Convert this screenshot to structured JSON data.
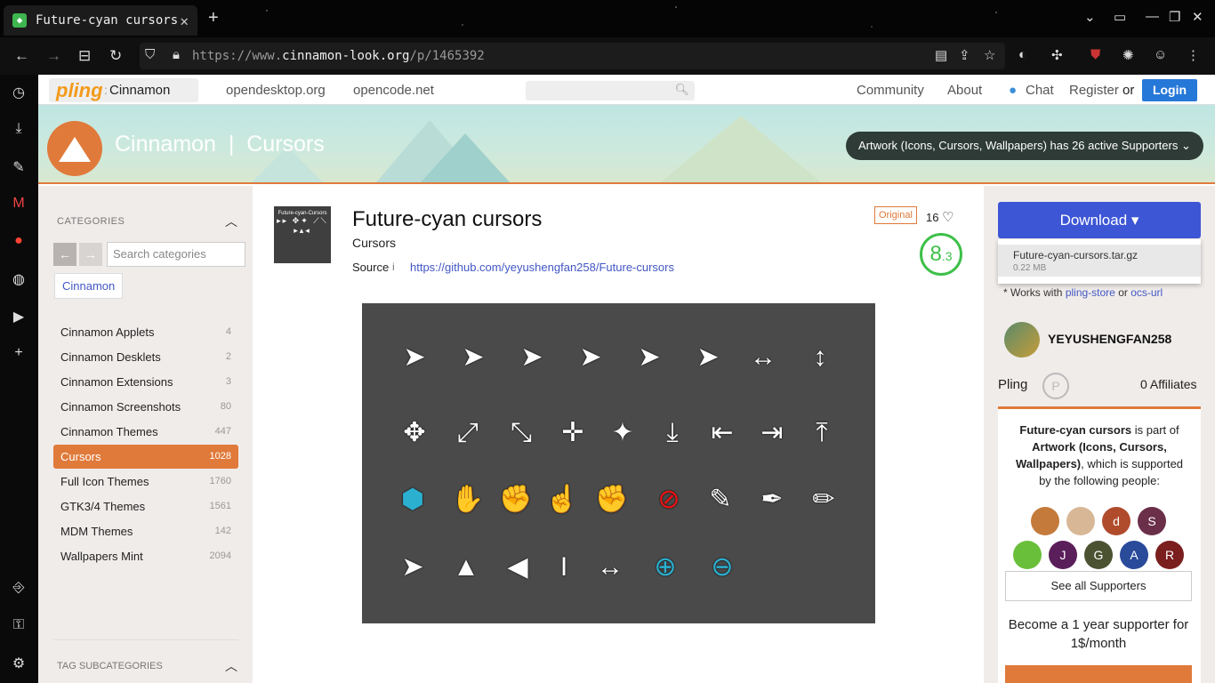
{
  "browser": {
    "tab_title": "Future-cyan cursors",
    "url_prefix": "https://www.",
    "url_domain": "cinnamon-look.org",
    "url_path": "/p/1465392"
  },
  "topnav": {
    "site_brand": "pling",
    "site_section": "Cinnamon",
    "links": [
      "opendesktop.org",
      "opencode.net"
    ],
    "community": "Community",
    "about": "About",
    "chat": "Chat",
    "register": "Register",
    "or": "or",
    "login": "Login"
  },
  "banner": {
    "title": "Cinnamon",
    "subtitle": "Cursors",
    "supporters_pill": "Artwork (Icons, Cursors, Wallpapers) has 26 active Supporters"
  },
  "categories": {
    "heading": "CATEGORIES",
    "search_placeholder": "Search categories",
    "current_chip": "Cinnamon",
    "items": [
      {
        "label": "Cinnamon Applets",
        "count": "4"
      },
      {
        "label": "Cinnamon Desklets",
        "count": "2"
      },
      {
        "label": "Cinnamon Extensions",
        "count": "3"
      },
      {
        "label": "Cinnamon Screenshots",
        "count": "80"
      },
      {
        "label": "Cinnamon Themes",
        "count": "447"
      },
      {
        "label": "Cursors",
        "count": "1028"
      },
      {
        "label": "Full Icon Themes",
        "count": "1760"
      },
      {
        "label": "GTK3/4 Themes",
        "count": "1561"
      },
      {
        "label": "MDM Themes",
        "count": "142"
      },
      {
        "label": "Wallpapers Mint",
        "count": "2094"
      }
    ],
    "tag_heading": "TAG SUBCATEGORIES"
  },
  "product": {
    "thumb_caption": "Future-cyan-Cursors",
    "title": "Future-cyan cursors",
    "category": "Cursors",
    "source_label": "Source",
    "source_info": "i",
    "source_url": "https://github.com/yeyushengfan258/Future-cursors",
    "badge": "Original",
    "likes": "16",
    "score_main": "8",
    "score_decimal": ".3"
  },
  "download": {
    "button": "Download",
    "file_name": "Future-cyan-cursors.tar.gz",
    "file_size": "0.22 MB",
    "works_prefix": "* Works with",
    "works_link1": "pling-store",
    "works_or": "or",
    "works_link2": "ocs-url"
  },
  "author": {
    "name": "YEYUSHENGFAN258",
    "pling_label": "Pling",
    "affiliates": "0 Affiliates"
  },
  "support_box": {
    "text_bold1": "Future-cyan cursors",
    "text1": "is part of",
    "text_bold2": "Artwork (Icons, Cursors, Wallpapers)",
    "text2": ", which is supported by the following people:",
    "supporters": [
      {
        "initial": "",
        "color": "#c47a3a"
      },
      {
        "initial": "",
        "color": "#d8b796"
      },
      {
        "initial": "d",
        "color": "#b04b2c"
      },
      {
        "initial": "S",
        "color": "#6b2f4a"
      },
      {
        "initial": "",
        "color": "#6abf3a"
      },
      {
        "initial": "J",
        "color": "#5a1e5a"
      },
      {
        "initial": "G",
        "color": "#4a5232"
      },
      {
        "initial": "A",
        "color": "#2a4a9a"
      },
      {
        "initial": "R",
        "color": "#7a1e1e"
      }
    ],
    "see_all": "See all Supporters",
    "become": "Become a 1 year supporter for 1$/month"
  }
}
